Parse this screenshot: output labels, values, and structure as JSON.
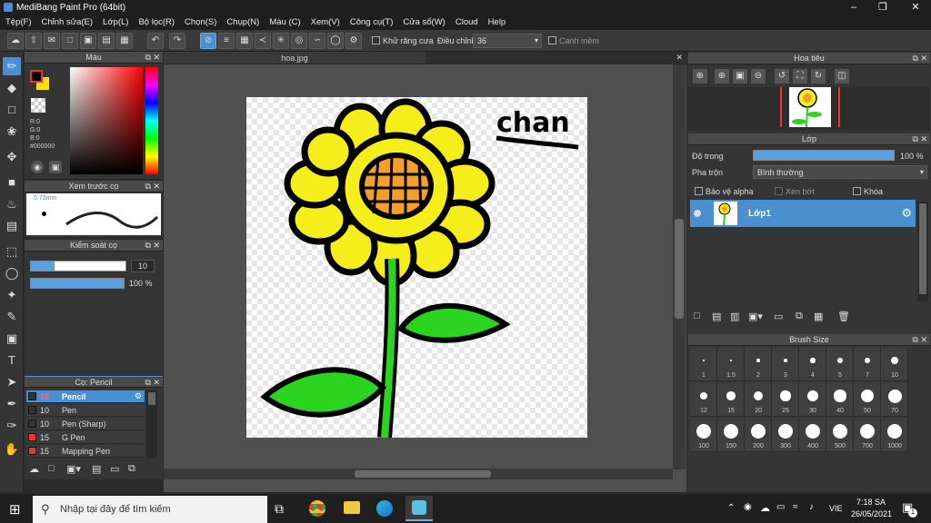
{
  "window": {
    "title": "MediBang Paint Pro (64bit)"
  },
  "menu": [
    "Tệp(F)",
    "Chỉnh sửa(E)",
    "Lớp(L)",
    "Bộ lọc(R)",
    "Chọn(S)",
    "Chụp(N)",
    "Màu (C)",
    "Xem(V)",
    "Công cụ(T)",
    "Cửa sổ(W)",
    "Cloud",
    "Help"
  ],
  "toolbar": {
    "antialias_label": "Khử răng cưa",
    "correction_label": "Điều chỉnh",
    "correction_value": "36",
    "edge_label": "Canh mềm"
  },
  "color_panel": {
    "title": "Màu",
    "rgb": [
      "R:0",
      "G:0",
      "B:0"
    ],
    "hex": "#000000",
    "foreground": "#000000",
    "background": "#f5e600"
  },
  "brush_preview": {
    "title": "Xem trước cọ",
    "size": "0.73mm"
  },
  "brush_control": {
    "title": "Kiểm soát cọ",
    "size": "10",
    "opacity": "100 %",
    "size_fraction": 0.25,
    "opacity_fraction": 1.0
  },
  "brush_panel": {
    "title": "Cọ: Pencil",
    "brushes": [
      {
        "color": "#333333",
        "size": "10",
        "name": "Pencil"
      },
      {
        "color": "#333333",
        "size": "10",
        "name": "Pen"
      },
      {
        "color": "#333333",
        "size": "10",
        "name": "Pen (Sharp)"
      },
      {
        "color": "#e53935",
        "size": "15",
        "name": "G Pen"
      },
      {
        "color": "#e53935",
        "size": "15",
        "name": "Mapping Pen"
      }
    ]
  },
  "canvas": {
    "tab": "hoa.jpg"
  },
  "navigator": {
    "title": "Hoa tiêu"
  },
  "layer_panel": {
    "title": "Lớp",
    "opacity_label": "Độ trong",
    "opacity": "100 %",
    "opacity_fraction": 1.0,
    "blend_label": "Pha trộn",
    "blend_value": "Bình thường",
    "protect_alpha": "Bảo vệ alpha",
    "clip": "Xén bớt",
    "lock": "Khóa",
    "layer_name": "Lớp1"
  },
  "brush_size": {
    "title": "Brush Size",
    "sizes": [
      "1",
      "1.5",
      "2",
      "3",
      "4",
      "5",
      "7",
      "10",
      "12",
      "15",
      "20",
      "25",
      "30",
      "40",
      "50",
      "70",
      "100",
      "150",
      "200",
      "300",
      "400",
      "500",
      "700",
      "1000"
    ]
  },
  "taskbar": {
    "search_placeholder": "Nhập tại đây để tìm kiếm",
    "lang": "VIE",
    "time": "7:18 SA",
    "date": "26/05/2021",
    "notifications": "1"
  },
  "artwork": {
    "signature": "chan"
  }
}
